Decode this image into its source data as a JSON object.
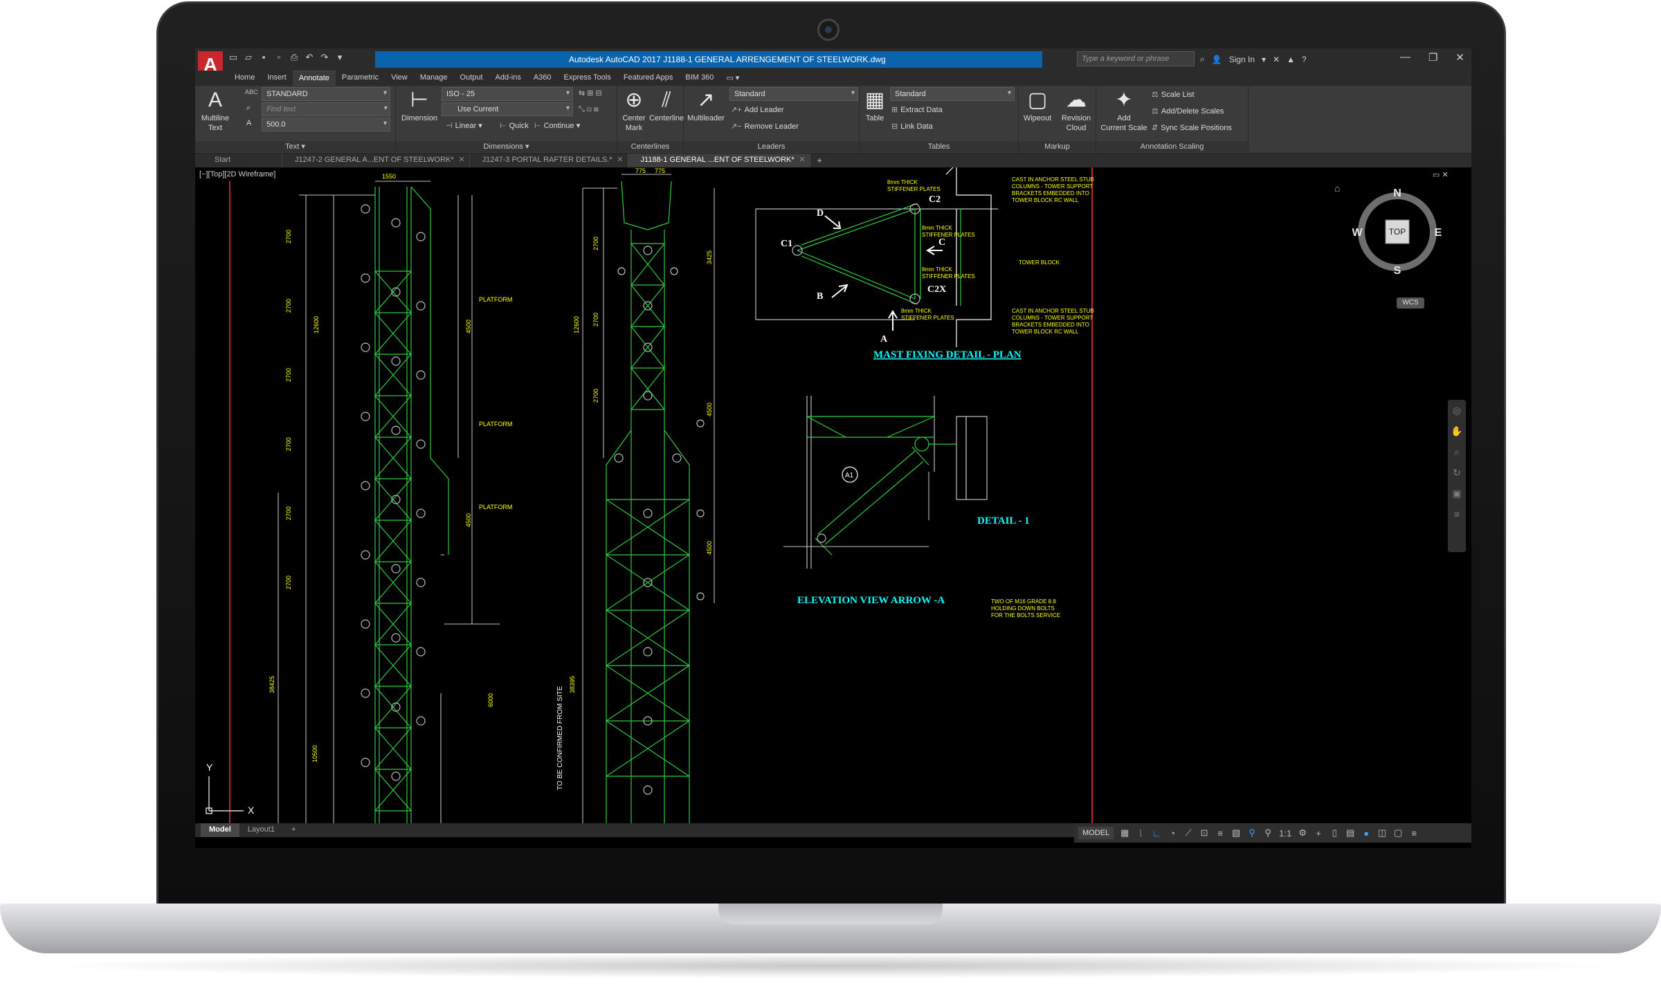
{
  "titlebar": {
    "title": "Autodesk AutoCAD 2017   J1188-1  GENERAL  ARRENGEMENT OF STEELWORK.dwg",
    "search_placeholder": "Type a keyword or phrase",
    "sign_in": "Sign In",
    "logo_letter": "A"
  },
  "ribbon_tabs": [
    "Home",
    "Insert",
    "Annotate",
    "Parametric",
    "View",
    "Manage",
    "Output",
    "Add-ins",
    "A360",
    "Express Tools",
    "Featured Apps",
    "BIM 360"
  ],
  "ribbon": {
    "text_panel": {
      "title": "Text",
      "multiline_text": "Multiline\nText",
      "style_value": "STANDARD",
      "find_placeholder": "Find text",
      "height_value": "500.0"
    },
    "dimensions_panel": {
      "title": "Dimensions",
      "dimension": "Dimension",
      "dim_style": "ISO - 25",
      "layer": "Use Current",
      "linear": "Linear",
      "quick": "Quick",
      "continue": "Continue"
    },
    "centerlines_panel": {
      "title": "Centerlines",
      "center_mark": "Center\nMark",
      "centerline": "Centerline"
    },
    "leaders_panel": {
      "title": "Leaders",
      "multileader": "Multileader",
      "style": "Standard",
      "add_leader": "Add Leader",
      "remove_leader": "Remove Leader"
    },
    "tables_panel": {
      "title": "Tables",
      "table": "Table",
      "style": "Standard",
      "extract_data": "Extract Data",
      "link_data": "Link Data"
    },
    "markup_panel": {
      "title": "Markup",
      "wipeout": "Wipeout",
      "revision_cloud": "Revision\nCloud"
    },
    "annotation_scaling_panel": {
      "title": "Annotation Scaling",
      "add_current_scale": "Add\nCurrent Scale",
      "scale_list": "Scale List",
      "add_delete_scales": "Add/Delete Scales",
      "sync_scale_positions": "Sync Scale Positions"
    }
  },
  "file_tabs": [
    "Start",
    "J1247-2 GENERAL A...ENT OF STEELWORK*",
    "J1247-3  PORTAL  RAFTER  DETAILS.*",
    "J1188-1  GENERAL  ...ENT OF STEELWORK*"
  ],
  "viewport_label": "[−][Top][2D Wireframe]",
  "drawing": {
    "title_plan": "MAST FIXING DETAIL - PLAN",
    "title_detail": "DETAIL - 1",
    "title_elevation": "ELEVATION VIEW  ARROW -A",
    "labels": [
      "C2",
      "C1",
      "C2X",
      "D",
      "B",
      "C",
      "A",
      "A1"
    ],
    "dims_top": [
      "1550",
      "775",
      "775"
    ],
    "platform": "PLATFORM",
    "note": "TO BE CONFIRMED FROM SITE",
    "dim_vertical": [
      "2700",
      "2700",
      "2700",
      "2700",
      "2700",
      "2700",
      "12600",
      "4500",
      "4500",
      "6000",
      "38425",
      "10500"
    ]
  },
  "viewcube": {
    "top": "TOP",
    "n": "N",
    "s": "S",
    "e": "E",
    "w": "W",
    "wcs": "WCS"
  },
  "ucs": {
    "x": "X",
    "y": "Y"
  },
  "layout_tabs": [
    "Model",
    "Layout1"
  ],
  "status": {
    "model": "MODEL",
    "scale": "1:1"
  },
  "colors": {
    "accent_blue": "#0a64ad",
    "cad_green": "#2ecc40",
    "cad_yellow": "#ffff00",
    "cad_cyan": "#00ffff",
    "logo_red": "#c9272b"
  }
}
